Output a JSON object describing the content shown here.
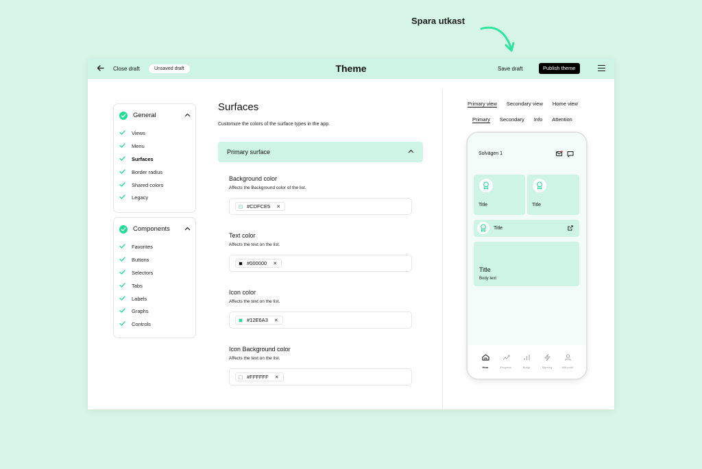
{
  "annotation": {
    "label": "Spara utkast"
  },
  "topbar": {
    "close_label": "Close draft",
    "draft_badge": "Unsaved draft",
    "title": "Theme",
    "save_label": "Save draft",
    "publish_label": "Publish theme"
  },
  "nav": {
    "general": {
      "label": "General",
      "items": [
        "Views",
        "Menu",
        "Surfaces",
        "Border radius",
        "Shared colors",
        "Legacy"
      ],
      "active": "Surfaces"
    },
    "components": {
      "label": "Components",
      "items": [
        "Favorites",
        "Buttons",
        "Selectors",
        "Tabs",
        "Labels",
        "Graphs",
        "Controls"
      ]
    }
  },
  "main": {
    "title": "Surfaces",
    "subtitle": "Customize the colors of the surface types in the app.",
    "accordion_label": "Primary surface",
    "fields": [
      {
        "title": "Background color",
        "desc": "Affects the Background color of the list.",
        "value": "#CDFCE5",
        "swatch": "#cdfce5"
      },
      {
        "title": "Text color",
        "desc": "Affects the text on the list.",
        "value": "#000000",
        "swatch": "#000000"
      },
      {
        "title": "Icon color",
        "desc": "Affects the text on the list.",
        "value": "#12E6A3",
        "swatch": "#12e6a3"
      },
      {
        "title": "Icon Background color",
        "desc": "Affects the text on the list.",
        "value": "#FFFFFF",
        "swatch": "#ffffff"
      }
    ]
  },
  "preview": {
    "view_tabs": [
      "Primary view",
      "Secondary view",
      "Home view"
    ],
    "active_view_tab": "Primary view",
    "type_tabs": [
      "Primary",
      "Secondary",
      "Info",
      "Attention"
    ],
    "active_type_tab": "Primary",
    "phone": {
      "header": "Solvägen 1",
      "tile_title": "Title",
      "big_title": "Title",
      "body_text": "Body text",
      "nav": [
        "Hem",
        "Progress",
        "Budgt",
        "Styrning",
        "Mitt profil"
      ],
      "active_nav": "Hem"
    }
  },
  "colors": {
    "accent": "#1fdc96",
    "surface": "#cdf4e4",
    "background": "#d6f5e7"
  }
}
